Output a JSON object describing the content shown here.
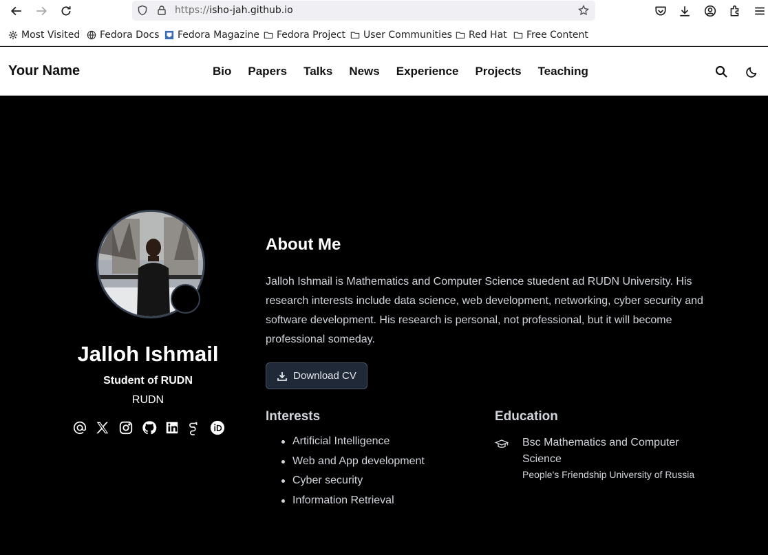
{
  "browser": {
    "url_scheme": "https://",
    "url_host": "isho-jah.github.io",
    "bookmarks": [
      "Most Visited",
      "Fedora Docs",
      "Fedora Magazine",
      "Fedora Project",
      "User Communities",
      "Red Hat",
      "Free Content"
    ]
  },
  "site": {
    "brand": "Your Name",
    "nav": [
      "Bio",
      "Papers",
      "Talks",
      "News",
      "Experience",
      "Projects",
      "Teaching"
    ]
  },
  "profile": {
    "name": "Jalloh Ishmail",
    "role": "Student of RUDN",
    "org": "RUDN",
    "socials": [
      "email-icon",
      "x-icon",
      "instagram-icon",
      "github-icon",
      "linkedin-icon",
      "google-scholar-icon",
      "orcid-icon"
    ]
  },
  "about": {
    "title": "About Me",
    "text": "Jalloh Ishmail is Mathematics and Computer Science stuedent ad RUDN University. His research interests include data science, web development, networking, cyber security and software development. His research is personal, not professional, but it will become professional someday.",
    "cv_label": "Download CV"
  },
  "interests": {
    "title": "Interests",
    "items": [
      "Artificial Intelligence",
      "Web and App development",
      "Cyber security",
      "Information Retrieval"
    ]
  },
  "education": {
    "title": "Education",
    "degree": "Bsc Mathematics and Computer Science",
    "school": "People's Friendship University of Russia"
  }
}
